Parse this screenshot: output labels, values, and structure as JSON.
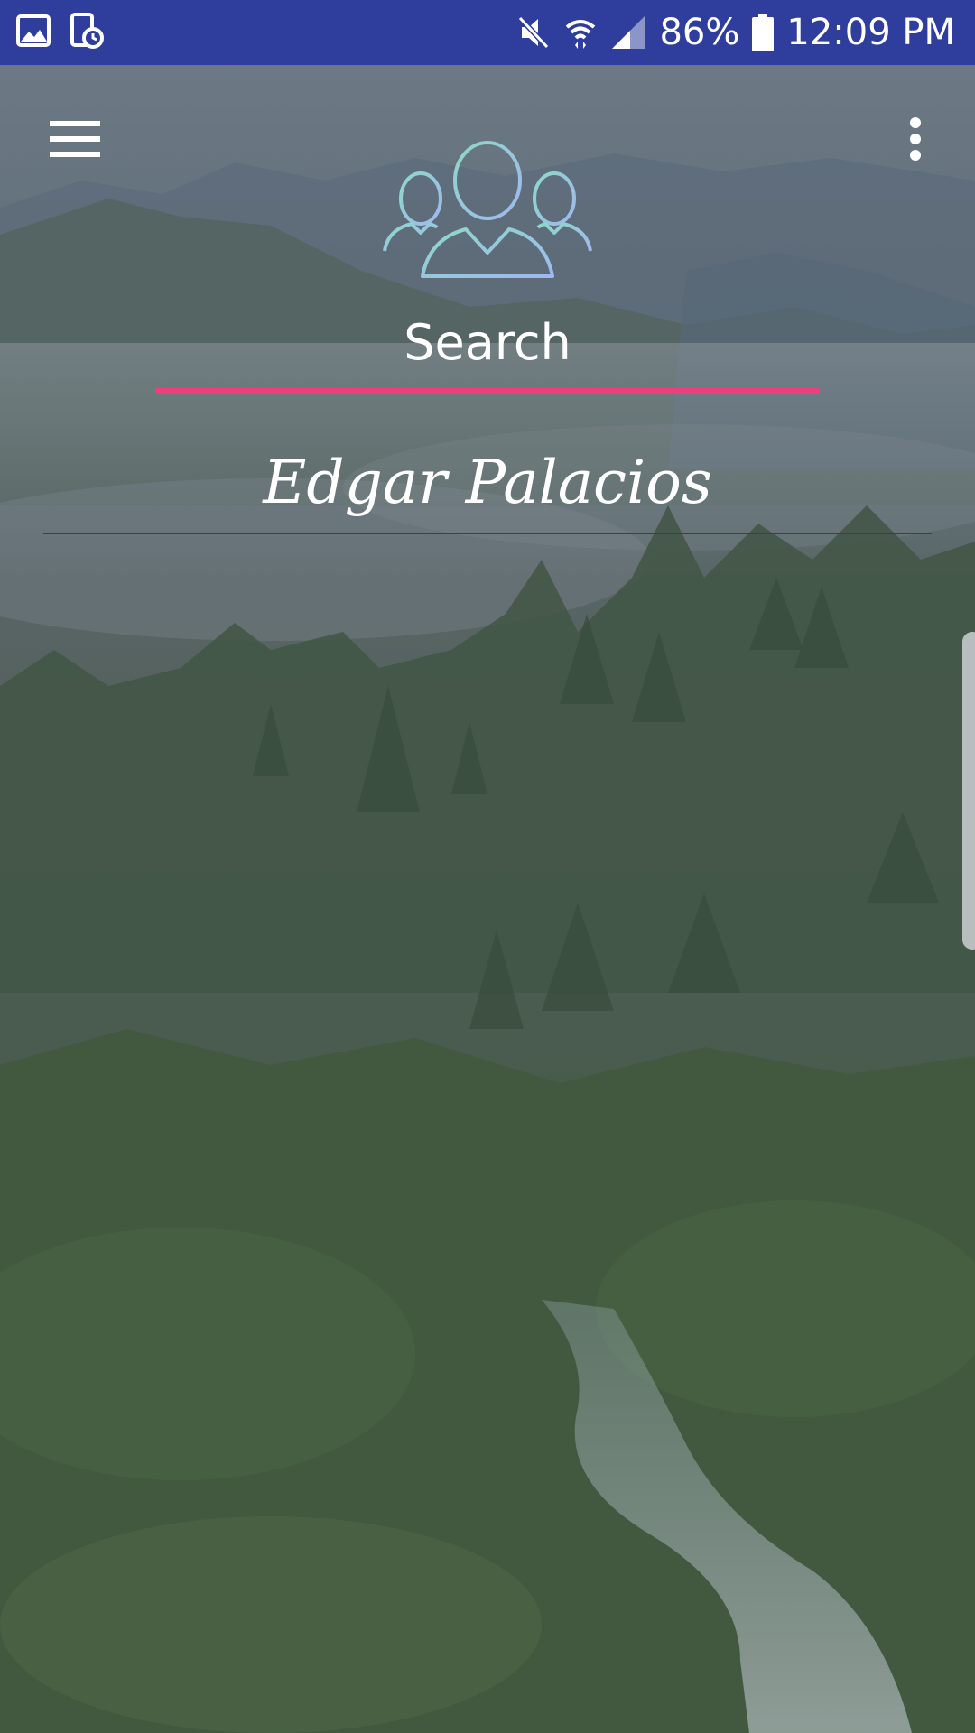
{
  "status_bar": {
    "left_icons": [
      "image-icon",
      "screen-timer-icon"
    ],
    "right_icons": [
      "mute-icon",
      "wifi-icon",
      "signal-icon",
      "battery-icon"
    ],
    "battery": "86%",
    "time": "12:09 PM"
  },
  "toolbar": {
    "menu_icon": "hamburger-menu-icon",
    "overflow_icon": "more-vert-icon"
  },
  "header": {
    "logo_icon": "users-group-icon",
    "tab_label": "Search",
    "name_value": "Edgar Palacios"
  },
  "colors": {
    "status_bar": "#2f3d9c",
    "tab_indicator": "#ee3e7b",
    "logo_gradient_start": "#8fd8c8",
    "logo_gradient_end": "#9fb8f0",
    "text": "#ffffff"
  }
}
